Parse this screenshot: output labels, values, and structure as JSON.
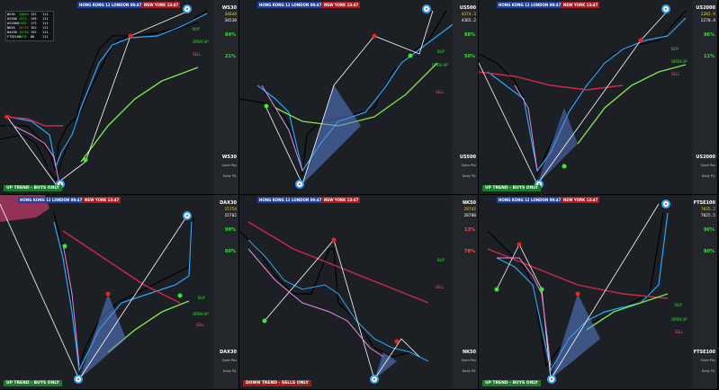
{
  "sessions": {
    "hk": "HONG KONG 13:47",
    "ld": "LONDON 09:47",
    "ny": "NEW YORK 13:47"
  },
  "panels": [
    {
      "symbol": "WS30",
      "price": "34644",
      "price2": "34510",
      "pct": "84%",
      "pct2": "21%",
      "bottom_symbol": "WS30",
      "trend": "UP TREND - BUYS ONLY",
      "trend_type": "up"
    },
    {
      "symbol": "US500",
      "price": "4374.3",
      "price2": "4365.2",
      "pct": "88%",
      "pct2": "50%",
      "bottom_symbol": "US500",
      "trend": "",
      "trend_type": "none"
    },
    {
      "symbol": "US2000",
      "price": "2282.9",
      "price2": "2270.4",
      "pct": "96%",
      "pct2": "11%",
      "bottom_symbol": "US2000",
      "trend": "UP TREND - BUYS ONLY",
      "trend_type": "up"
    },
    {
      "symbol": "DAX30",
      "price": "15754",
      "price2": "15702",
      "pct": "99%",
      "pct2": "60%",
      "bottom_symbol": "DAX30",
      "trend": "UP TREND - BUYS ONLY",
      "trend_type": "up"
    },
    {
      "symbol": "NK50",
      "price": "28742",
      "price2": "28780",
      "pct": "13%",
      "pct2": "78%",
      "bottom_symbol": "NK50",
      "trend": "DOWN TREND - SELLS ONLY",
      "trend_type": "down"
    },
    {
      "symbol": "FTSE100",
      "price": "7035.2",
      "price2": "7025.5",
      "pct": "96%",
      "pct2": "80%",
      "bottom_symbol": "FTSE100",
      "trend": "UP TREND - BUYS ONLY",
      "trend_type": "up"
    }
  ],
  "labels": {
    "buy": "BUY",
    "sell": "SELL",
    "open_up": "OPEN UP",
    "daily": "Daily P/L",
    "open": "Open Pos"
  },
  "table": {
    "rows": [
      [
        "WS30",
        "34644",
        "131",
        "111"
      ],
      [
        "US500",
        "4374",
        "158",
        "111"
      ],
      [
        "US2000",
        "2282",
        "173",
        "111"
      ],
      [
        "NK50",
        "28742",
        "162",
        "111"
      ],
      [
        "DAX30",
        "15754",
        "192",
        "111"
      ],
      [
        "FTSE100",
        "7035",
        "86",
        "111"
      ]
    ]
  }
}
